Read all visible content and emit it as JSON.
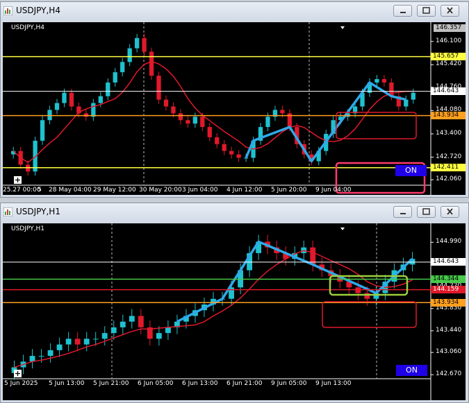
{
  "colors": {
    "bull": "#1ec2cf",
    "bear": "#e0192b",
    "ma": "#e0192b",
    "zigzag": "#2fa8e8",
    "yellow": "#ffff40",
    "orange": "#ff9f1e",
    "green": "#47c94a",
    "red": "#e0192b",
    "white": "#ffffff",
    "on_bg": "#1f00e8"
  },
  "window_h4": {
    "title": "USDJPY,H4",
    "chart_label": "USDJPY,H4",
    "price_axis": [
      "146.100",
      "145.420",
      "144.760",
      "144.080",
      "143.400",
      "142.720",
      "142.060"
    ],
    "top_price": "146.357",
    "level_labels": [
      {
        "text": "145.657",
        "price": 145.657,
        "color": "yellow"
      },
      {
        "text": "144.643",
        "price": 144.643,
        "color": "white"
      },
      {
        "text": "143.934",
        "price": 143.934,
        "color": "orange"
      },
      {
        "text": "142.411",
        "price": 142.411,
        "color": "yellow"
      }
    ],
    "time_axis": [
      "25.27 00:00",
      "5",
      "28 May 04:00",
      "29 May 12:00",
      "30 May 20:00",
      "3 Jun 04:00",
      "4 Jun 12:00",
      "5 Jun 20:00",
      "9 Jun 04:00"
    ],
    "on_label": "ON"
  },
  "window_h1": {
    "title": "USDJPY,H1",
    "chart_label": "USDJPY,H1",
    "price_axis": [
      "144.990",
      "144.600",
      "144.220",
      "143.830",
      "143.440",
      "143.060",
      "142.670"
    ],
    "level_labels": [
      {
        "text": "144.643",
        "price": 144.643,
        "color": "white"
      },
      {
        "text": "144.344",
        "price": 144.344,
        "color": "green"
      },
      {
        "text": "144.159",
        "price": 144.159,
        "color": "red"
      },
      {
        "text": "143.934",
        "price": 143.934,
        "color": "orange"
      }
    ],
    "time_axis": [
      "5 Jun 2025",
      "5 Jun 13:00",
      "5 Jun 21:00",
      "6 Jun 05:00",
      "6 Jun 13:00",
      "6 Jun 21:00",
      "9 Jun 05:00",
      "9 Jun 13:00"
    ],
    "on_label": "ON"
  },
  "chart_data": [
    {
      "type": "line",
      "title": "USDJPY,H4",
      "ylim": [
        141.9,
        146.5
      ],
      "series": [
        {
          "name": "USDJPY,H4",
          "values": [
            142.9,
            142.5,
            142.3,
            143.2,
            143.8,
            144.1,
            144.3,
            144.6,
            144.2,
            144.0,
            143.9,
            144.3,
            144.5,
            144.9,
            145.2,
            145.5,
            145.9,
            146.2,
            145.8,
            145.1,
            144.4,
            144.2,
            144.0,
            143.8,
            143.7,
            143.9,
            143.6,
            143.3,
            143.1,
            142.9,
            142.8,
            142.7,
            142.7,
            143.2,
            143.6,
            143.9,
            144.1,
            144.0,
            143.6,
            143.1,
            142.8,
            142.6,
            142.9,
            143.4,
            143.8,
            143.9,
            144.0,
            144.2,
            144.6,
            144.9,
            145.0,
            144.9,
            144.5,
            144.2,
            144.4,
            144.6
          ]
        }
      ]
    },
    {
      "type": "line",
      "title": "USDJPY,H1",
      "ylim": [
        142.6,
        145.2
      ],
      "series": [
        {
          "name": "USDJPY,H1",
          "values": [
            142.8,
            142.9,
            143.0,
            143.0,
            143.1,
            143.2,
            143.3,
            143.2,
            143.3,
            143.3,
            143.4,
            143.5,
            143.6,
            143.7,
            143.5,
            143.3,
            143.4,
            143.5,
            143.6,
            143.7,
            143.8,
            143.9,
            144.0,
            144.0,
            144.2,
            144.5,
            144.8,
            145.0,
            144.9,
            144.8,
            144.7,
            144.8,
            144.9,
            144.6,
            144.5,
            144.4,
            144.3,
            144.2,
            144.1,
            144.0,
            144.1,
            144.3,
            144.5,
            144.6,
            144.7
          ]
        }
      ]
    }
  ]
}
